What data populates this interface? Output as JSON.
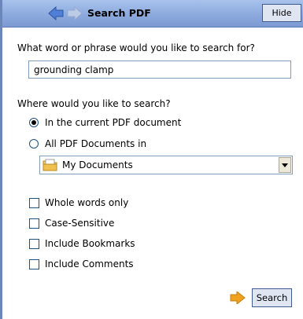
{
  "header": {
    "title": "Search PDF",
    "hide_label": "Hide",
    "back_icon": "back-arrow-icon",
    "forward_icon": "forward-arrow-icon"
  },
  "search": {
    "question": "What word or phrase would you like to search for?",
    "value": "grounding clamp"
  },
  "location": {
    "question": "Where would you like to search?",
    "options": [
      {
        "label": "In the current PDF document",
        "checked": true
      },
      {
        "label": "All PDF Documents in",
        "checked": false
      }
    ],
    "folder": {
      "value": "My Documents",
      "icon": "folder-icon"
    }
  },
  "checkboxes": [
    {
      "label": "Whole words only",
      "checked": false
    },
    {
      "label": "Case-Sensitive",
      "checked": false
    },
    {
      "label": "Include Bookmarks",
      "checked": false
    },
    {
      "label": "Include Comments",
      "checked": false
    }
  ],
  "footer": {
    "search_label": "Search",
    "arrow_icon": "orange-arrow-icon"
  },
  "colors": {
    "header_blue": "#8aa8dc",
    "arrow_orange": "#f0a21e",
    "button_border": "#415a8f"
  }
}
